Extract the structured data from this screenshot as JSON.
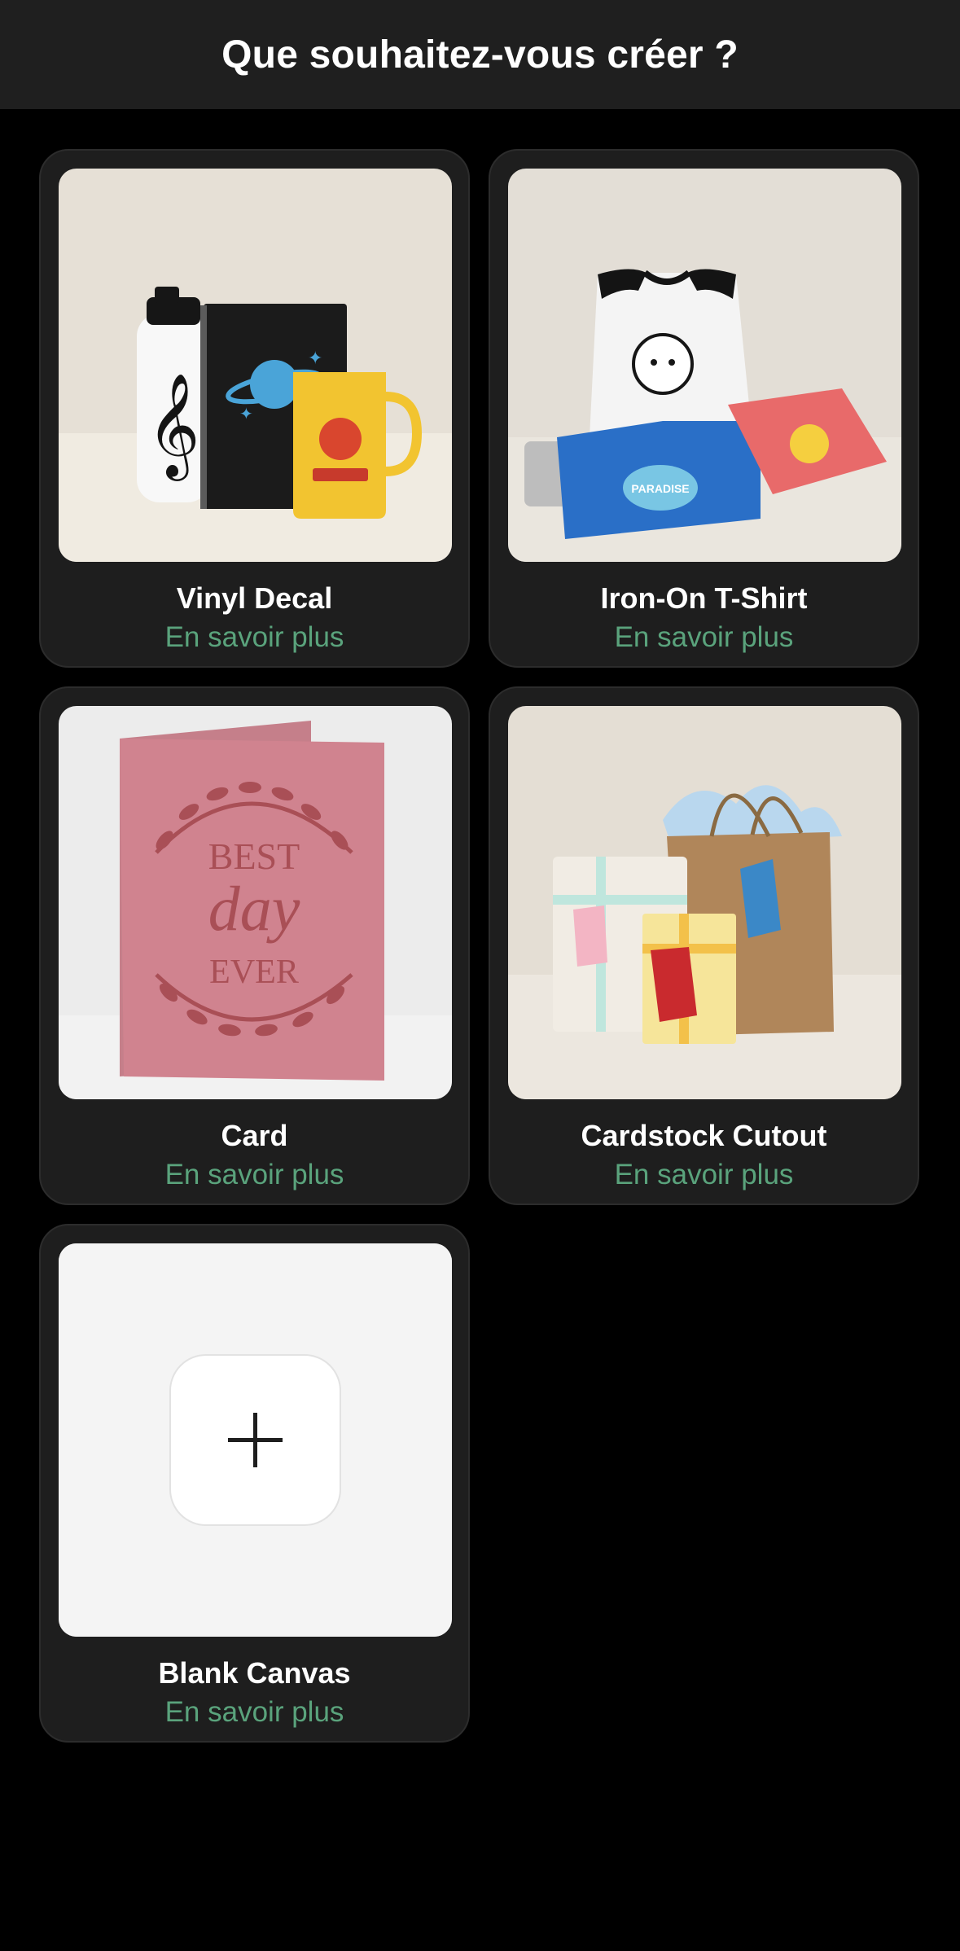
{
  "header": {
    "title": "Que souhaitez-vous créer ?"
  },
  "colors": {
    "background": "#000000",
    "header": "#1f1f1f",
    "card": "#1e1e1e",
    "link": "#5aa37c"
  },
  "projects": [
    {
      "title": "Vinyl Decal",
      "link": "En savoir plus",
      "icon": "vinyl-decal-photo"
    },
    {
      "title": "Iron-On T-Shirt",
      "link": "En savoir plus",
      "icon": "iron-on-tshirt-photo",
      "shirt_text": "PARADISE"
    },
    {
      "title": "Card",
      "link": "En savoir plus",
      "icon": "greeting-card-photo",
      "card_text": [
        "BEST",
        "day",
        "EVER"
      ]
    },
    {
      "title": "Cardstock Cutout",
      "link": "En savoir plus",
      "icon": "gift-bag-photo"
    },
    {
      "title": "Blank Canvas",
      "link": "En savoir plus",
      "icon": "plus-icon"
    }
  ]
}
